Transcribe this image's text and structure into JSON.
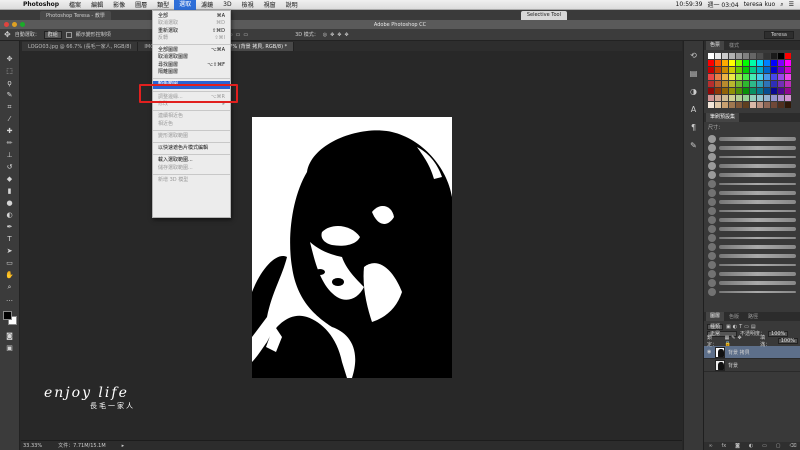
{
  "macmenu": {
    "app": "Photoshop",
    "items": [
      "檔案",
      "編輯",
      "影像",
      "圖層",
      "類型",
      "選取",
      "濾鏡",
      "3D",
      "檢視",
      "視窗",
      "說明"
    ],
    "active_index": 5,
    "status": [
      "10:59:39",
      "週一 03:04",
      "teresa kuo"
    ]
  },
  "browser_tabs": [
    "Photoshop Teresa - 教學",
    "Selective Tool"
  ],
  "window_title": "Adobe Photoshop CC",
  "options_bar": {
    "auto_select_label": "自動選取：",
    "auto_select_value": "群組",
    "show_transform": "顯示變形控制項",
    "mode_3d": "3D 模式：",
    "workspace": "Teresa"
  },
  "doc_tabs": [
    "LOGO03.jpg @ 66.7% (長毛一家人, RGB/8)",
    "IMG_",
    "6.7% (背景 拷貝, RGB/8) *"
  ],
  "select_menu": [
    {
      "label": "全部",
      "shortcut": "⌘A",
      "disabled": false
    },
    {
      "label": "取消選取",
      "shortcut": "⌘D",
      "disabled": true
    },
    {
      "label": "重新選取",
      "shortcut": "⇧⌘D",
      "disabled": false
    },
    {
      "label": "反轉",
      "shortcut": "⇧⌘I",
      "disabled": true
    },
    {
      "sep": true
    },
    {
      "label": "全部圖層",
      "shortcut": "⌥⌘A",
      "disabled": false
    },
    {
      "label": "取消選取圖層",
      "shortcut": "",
      "disabled": false
    },
    {
      "label": "尋找圖層",
      "shortcut": "⌥⇧⌘F",
      "disabled": false
    },
    {
      "label": "隔離圖層",
      "shortcut": "",
      "disabled": false
    },
    {
      "sep": true
    },
    {
      "label": "顏色範圍...",
      "shortcut": "",
      "highlighted": true
    },
    {
      "sep": true
    },
    {
      "label": "調整邊緣...",
      "shortcut": "⌥⌘R",
      "disabled": true
    },
    {
      "label": "修改",
      "shortcut": "▸",
      "disabled": true
    },
    {
      "sep": true
    },
    {
      "label": "連續相近色",
      "shortcut": "",
      "disabled": true
    },
    {
      "label": "相近色",
      "shortcut": "",
      "disabled": true
    },
    {
      "sep": true
    },
    {
      "label": "變形選取範圍",
      "shortcut": "",
      "disabled": true
    },
    {
      "sep": true
    },
    {
      "label": "以快速遮色片模式編輯",
      "shortcut": "",
      "disabled": false
    },
    {
      "sep": true
    },
    {
      "label": "載入選取範圍...",
      "shortcut": "",
      "disabled": false
    },
    {
      "label": "儲存選取範圍...",
      "shortcut": "",
      "disabled": true
    },
    {
      "sep": true
    },
    {
      "label": "新增 3D 模型",
      "shortcut": "",
      "disabled": true
    }
  ],
  "status_bar": {
    "zoom": "33.33%",
    "doc": "文件：7.71M/15.1M"
  },
  "panels": {
    "swatches_tabs": [
      "色票",
      "樣式"
    ],
    "brush_tabs": [
      "筆刷預設集"
    ],
    "brush_size_label": "尺寸：",
    "layers_tabs": [
      "圖層",
      "色版",
      "路徑"
    ],
    "kind_label": "種類",
    "blend_mode": "正常",
    "opacity_label": "不透明度：",
    "opacity": "100%",
    "lock_label": "鎖定：",
    "fill_label": "填滿：",
    "fill": "100%",
    "layers": [
      {
        "name": "背景 拷貝",
        "active": true
      },
      {
        "name": "背景",
        "active": false
      }
    ]
  },
  "watermark": {
    "line1": "enjoy life",
    "line2": "長毛一家人"
  },
  "colors": {
    "accent": "#2a62d3",
    "highlight_box": "#e1201f",
    "canvas_bg": "#282828"
  }
}
